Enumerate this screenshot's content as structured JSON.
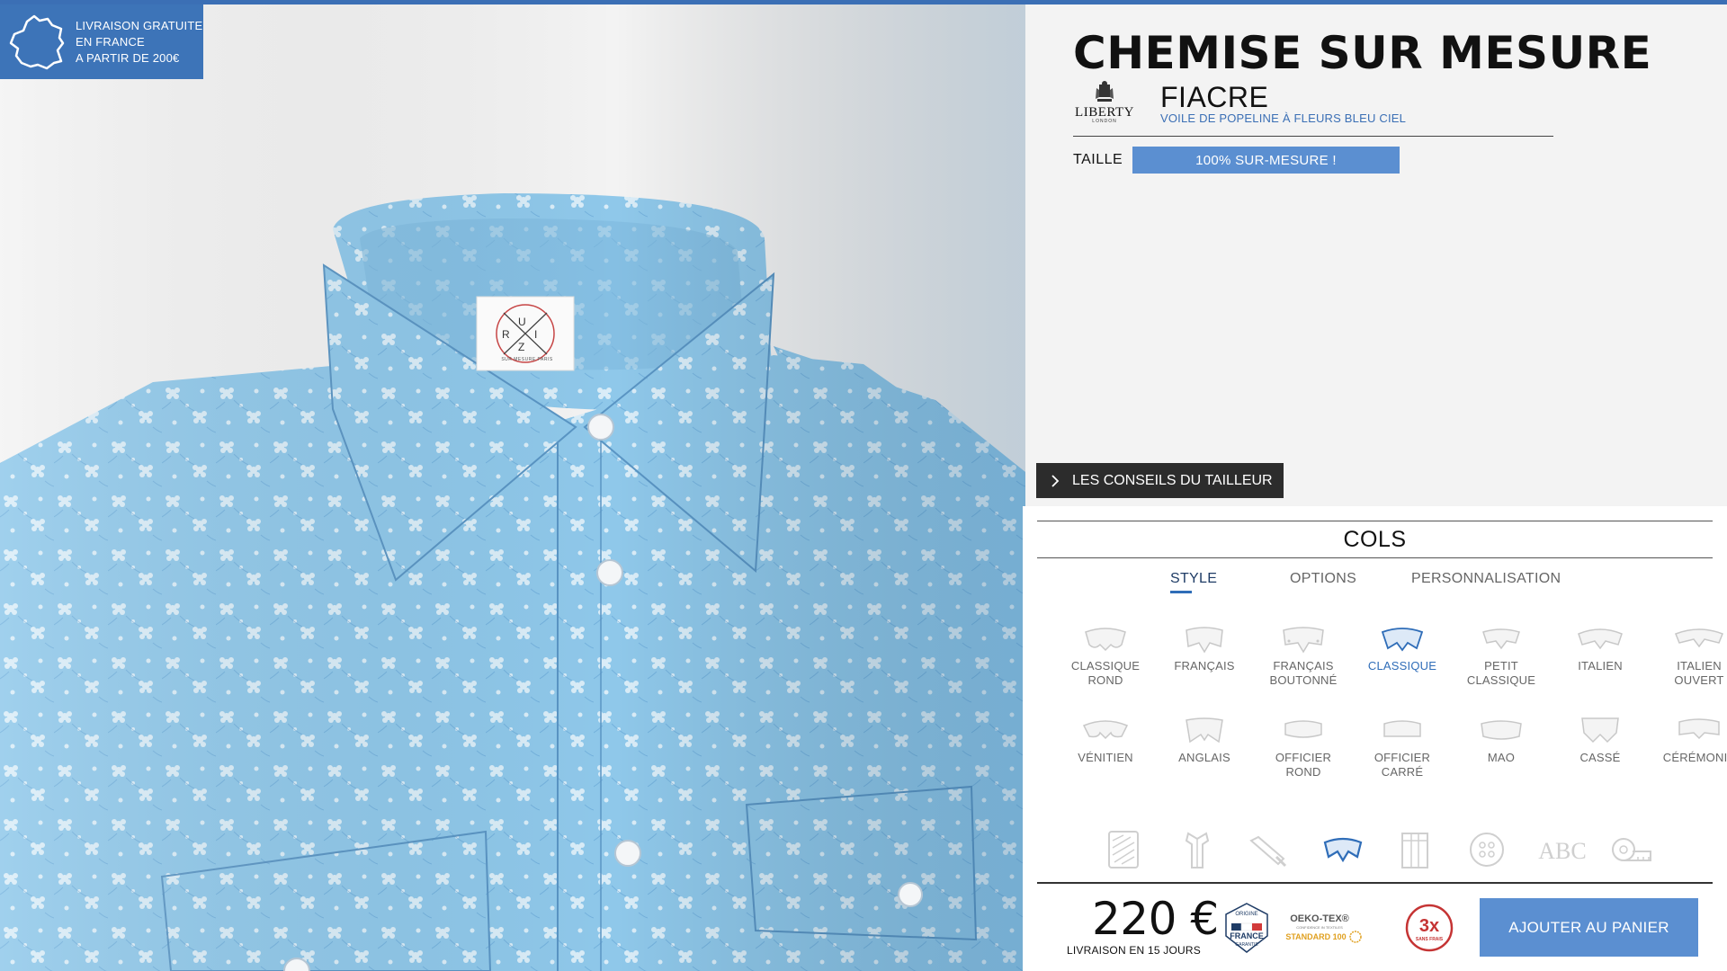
{
  "shipping_badge": {
    "lines": [
      "LIVRAISON GRATUITE",
      "EN FRANCE",
      "A PARTIR DE 200€"
    ],
    "icon": "france-map-icon"
  },
  "product": {
    "title": "CHEMISE SUR MESURE",
    "brand": "LIBERTY",
    "brand_sub": "LONDON",
    "fabric_name": "FIACRE",
    "fabric_description": "VOILE DE POPELINE À FLEURS BLEU CIEL"
  },
  "size": {
    "label": "TAILLE",
    "value": "100% SUR-MESURE !"
  },
  "shirt_label": {
    "letters": [
      "R",
      "U",
      "I",
      "Z"
    ],
    "tagline": "SUR MESURE PARIS"
  },
  "advice_button": "LES CONSEILS DU TAILLEUR",
  "panel": {
    "title": "COLS",
    "tabs": [
      {
        "label": "STYLE",
        "active": true
      },
      {
        "label": "OPTIONS",
        "active": false
      },
      {
        "label": "PERSONNALISATION",
        "active": false
      }
    ],
    "collars": [
      {
        "line1": "CLASSIQUE",
        "line2": "ROND",
        "selected": false
      },
      {
        "line1": "FRANÇAIS",
        "line2": "",
        "selected": false
      },
      {
        "line1": "FRANÇAIS",
        "line2": "BOUTONNÉ",
        "selected": false
      },
      {
        "line1": "CLASSIQUE",
        "line2": "",
        "selected": true
      },
      {
        "line1": "PETIT",
        "line2": "CLASSIQUE",
        "selected": false
      },
      {
        "line1": "ITALIEN",
        "line2": "",
        "selected": false
      },
      {
        "line1": "ITALIEN",
        "line2": "OUVERT",
        "selected": false
      },
      {
        "line1": "VÉNITIEN",
        "line2": "",
        "selected": false
      },
      {
        "line1": "ANGLAIS",
        "line2": "",
        "selected": false
      },
      {
        "line1": "OFFICIER",
        "line2": "ROND",
        "selected": false
      },
      {
        "line1": "OFFICIER",
        "line2": "CARRÉ",
        "selected": false
      },
      {
        "line1": "MAO",
        "line2": "",
        "selected": false
      },
      {
        "line1": "CASSÉ",
        "line2": "",
        "selected": false
      },
      {
        "line1": "CÉRÉMONIE",
        "line2": "",
        "selected": false
      }
    ],
    "categories": [
      {
        "icon": "fabric-swatch-icon",
        "active": false
      },
      {
        "icon": "shirt-fit-icon",
        "active": false
      },
      {
        "icon": "sleeve-icon",
        "active": false
      },
      {
        "icon": "collar-icon",
        "active": true
      },
      {
        "icon": "placket-icon",
        "active": false
      },
      {
        "icon": "button-icon",
        "active": false
      },
      {
        "icon": "monogram-icon",
        "active": false
      },
      {
        "icon": "measuring-tape-icon",
        "active": false
      }
    ],
    "monogram_text": "ABC"
  },
  "footer": {
    "price": "220 €",
    "delivery": "LIVRAISON EN 15 JOURS",
    "badges": {
      "france_top": "ORIGINE",
      "france_main": "FRANCE",
      "france_bottom": "GARANTIE",
      "oeko_main": "OEKO-TEX®",
      "oeko_sub": "CONFIDENCE IN TEXTILES",
      "oeko_standard": "STANDARD 100",
      "pay_main": "3x",
      "pay_sub": "SANS FRAIS"
    },
    "cart_button": "AJOUTER AU PANIER"
  },
  "colors": {
    "accent": "#5b8fd1",
    "brand_blue": "#3d74b8",
    "shirt_fabric": "#8fc8ea",
    "selected": "#2f6db8"
  }
}
